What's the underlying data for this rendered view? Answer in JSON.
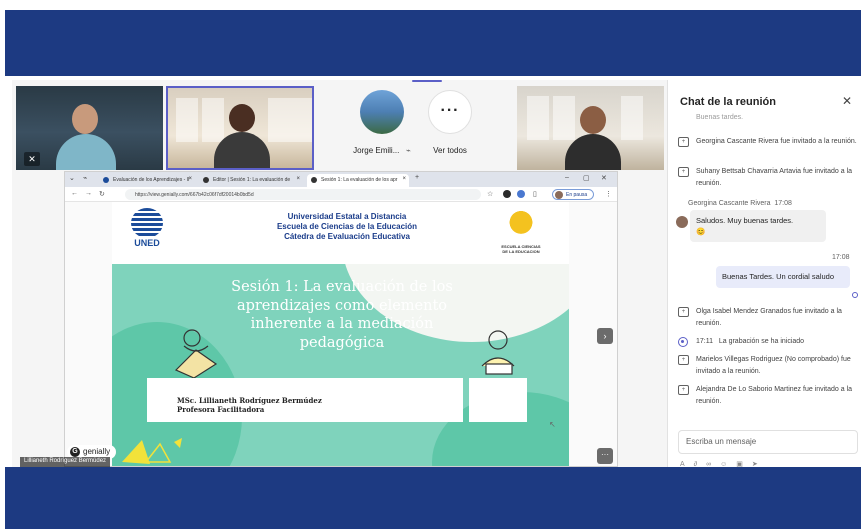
{
  "colors": {
    "banner": "#1d3a82",
    "accent": "#5b5fc7",
    "slide_green": "#7fd3bc",
    "uned_blue": "#1c4c9a"
  },
  "participants": {
    "avatar_name": "Jorge Emili...",
    "more_label": "Ver todos",
    "more_glyph": "···",
    "muted_glyph": "✕"
  },
  "browser": {
    "tabs": [
      {
        "label": "Evaluación de los Aprendizajes - II",
        "close": "×"
      },
      {
        "label": "Editor | Sesión 1: La evaluación de",
        "close": "×"
      },
      {
        "label": "Sesión 1: La evaluación de los apr",
        "close": "×"
      }
    ],
    "new_tab": "+",
    "url": "https://view.genially.com/667b42c06f7df20014b0bd5d",
    "pause_label": "En pausa"
  },
  "slide": {
    "institution": [
      "Universidad Estatal a Distancia",
      "Escuela de Ciencias de la Educación",
      "Cátedra de Evaluación Educativa"
    ],
    "logo_left": "UNED",
    "logo_right": [
      "ESCUELA CIENCIAS",
      "DE LA EDUCACION"
    ],
    "title": "Sesión 1: La evaluación de los aprendizajes como elemento inherente a la mediación pedagógica",
    "presenter_name": "MSc. Lillianeth Rodríguez Bermúdez",
    "presenter_role": "Profesora Facilitadora",
    "genially_brand": "genially",
    "genially_g": "G"
  },
  "share_nametag": "Lillianeth Rodríguez Bermúdez",
  "chat": {
    "title": "Chat de la reunión",
    "close": "✕",
    "top_fragment": "Buenas tardes.",
    "events_a": [
      "Georgina Cascante Rivera fue invitado a la reunión.",
      "Suhany Bettsab Chavarria Artavia fue invitado a la reunión."
    ],
    "msg1": {
      "author": "Georgina Cascante Rivera",
      "time": "17:08",
      "text": "Saludos. Muy buenas tardes.",
      "emoji": "😊"
    },
    "msg2": {
      "time": "17:08",
      "text": "Buenas Tardes. Un cordial saludo"
    },
    "events_b": [
      "Olga Isabel Mendez Granados fue invitado a la reunión.",
      "Marielos Villegas Rodriguez (No comprobado) fue invitado a la reunión.",
      "Alejandra De Lo Saborio Martinez fue invitado a la reunión."
    ],
    "recording": {
      "time": "17:11",
      "text": "La grabación se ha iniciado"
    },
    "compose_placeholder": "Escriba un mensaje"
  }
}
